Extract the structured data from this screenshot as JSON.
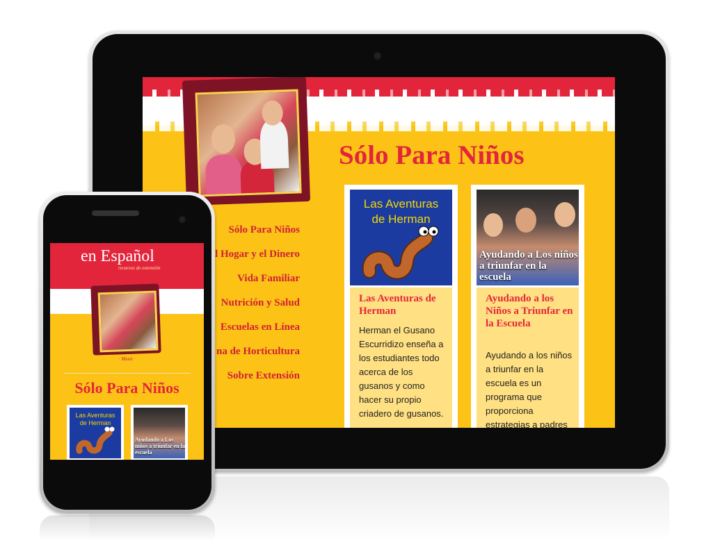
{
  "tablet": {
    "page_title": "Sólo Para Niños",
    "nav": [
      "Sólo Para Niños",
      "l Hogar y el Dinero",
      "Vida Familiar",
      "Nutrición y Salud",
      "Escuelas en Línea",
      "na de Horticultura",
      "Sobre Extensión"
    ],
    "cards": [
      {
        "image_text_1": "Las Aventuras",
        "image_text_2": "de Herman",
        "title": "Las Aventuras de Herman",
        "text": "Herman el Gusano Escurridizo enseña a los estudiantes todo acerca de los gusanos y como hacer su propio criadero de gusanos."
      },
      {
        "image_text": "Ayudando a Los niños a triunfar en la escuela",
        "title": "Ayudando a los Niños a Triunfar en la Escuela",
        "text": "Ayudando a los niños a triunfar en la escuela es un programa que proporciona estrategias a padres"
      }
    ]
  },
  "phone": {
    "logo": "en Español",
    "tagline": "recursos de extensión",
    "menu": "· Menú ·",
    "page_title": "Sólo Para Niños",
    "card1_text_1": "Las Aventuras",
    "card1_text_2": "de Herman",
    "card2_text": "Ayudando a Los niños a triunfar en la escuela"
  },
  "colors": {
    "red": "#e3253b",
    "yellow": "#fcc316",
    "card_body": "#ffe082",
    "herman_blue": "#1c3ba0"
  }
}
